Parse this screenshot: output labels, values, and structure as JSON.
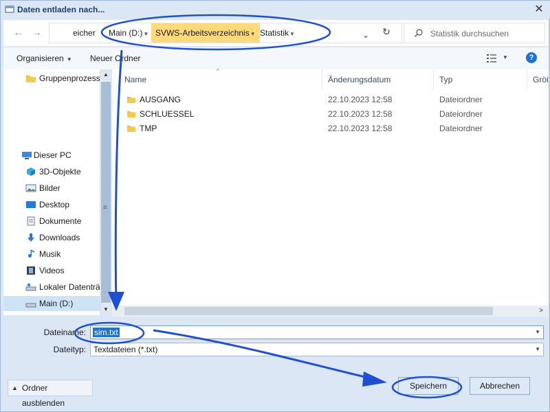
{
  "window": {
    "title": "Daten entladen nach...",
    "close_glyph": "✕"
  },
  "address": {
    "back_glyph": "←",
    "forward_glyph": "→",
    "up_glyph": "↑",
    "crumbs": [
      "eicher",
      "Main (D:)",
      "SVWS-Arbeitsverzeichnis",
      "Statistik"
    ],
    "dropdown_glyph": "⌄",
    "refresh_glyph": "↻",
    "search_placeholder": "Statistik durchsuchen"
  },
  "toolbar": {
    "organize_label": "Organisieren",
    "new_folder_label": "Neuer Ordner",
    "help_glyph": "?"
  },
  "nav": {
    "items": [
      {
        "label": "Gruppenprozess",
        "icon": "folder-icon"
      },
      {
        "label": "Dieser PC",
        "icon": "pc-icon"
      },
      {
        "label": "3D-Objekte",
        "icon": "3d-objects-icon"
      },
      {
        "label": "Bilder",
        "icon": "pictures-icon"
      },
      {
        "label": "Desktop",
        "icon": "desktop-icon"
      },
      {
        "label": "Dokumente",
        "icon": "documents-icon"
      },
      {
        "label": "Downloads",
        "icon": "downloads-icon"
      },
      {
        "label": "Musik",
        "icon": "music-icon"
      },
      {
        "label": "Videos",
        "icon": "videos-icon"
      },
      {
        "label": "Lokaler Datenträger",
        "icon": "drive-icon"
      },
      {
        "label": "Main (D:)",
        "icon": "drive-icon",
        "selected": true
      }
    ]
  },
  "filelist": {
    "columns": [
      "Name",
      "Änderungsdatum",
      "Typ",
      "Größe"
    ],
    "rows": [
      {
        "name": "AUSGANG",
        "date": "22.10.2023 12:58",
        "type": "Dateiordner"
      },
      {
        "name": "SCHLUESSEL",
        "date": "22.10.2023 12:58",
        "type": "Dateiordner"
      },
      {
        "name": "TMP",
        "date": "22.10.2023 12:58",
        "type": "Dateiordner"
      }
    ]
  },
  "form": {
    "filename_label": "Dateiname:",
    "filename_value": "sim.txt",
    "filetype_label": "Dateityp:",
    "filetype_value": "Textdateien (*.txt)"
  },
  "buttons": {
    "hide_folders": "Ordner ausblenden",
    "save": "Speichern",
    "cancel": "Abbrechen"
  },
  "colors": {
    "window_bg": "#dce7f5",
    "selection": "#1c73d6",
    "crumb_highlight": "#ffd97a",
    "annotation": "#1f4fd1"
  }
}
